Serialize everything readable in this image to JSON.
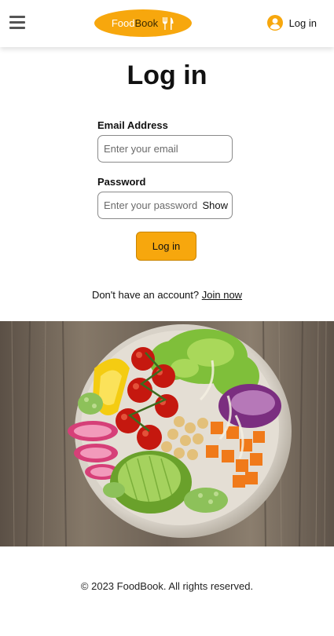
{
  "header": {
    "menu_icon": "hamburger-menu-icon",
    "logo": {
      "part1": "Food",
      "part2": "Book",
      "icon": "fork-knife-icon"
    },
    "login": {
      "icon": "user-circle-icon",
      "label": "Log in"
    }
  },
  "main": {
    "title": "Log in",
    "email": {
      "label": "Email Address",
      "placeholder": "Enter your email",
      "value": ""
    },
    "password": {
      "label": "Password",
      "placeholder": "Enter your password",
      "value": "",
      "toggle_label": "Show"
    },
    "submit_label": "Log in",
    "signup": {
      "prompt": "Don't have an account? ",
      "link": "Join now"
    }
  },
  "hero": {
    "alt": "Salad bowl"
  },
  "footer": {
    "text": "© 2023 FoodBook. All rights reserved."
  },
  "colors": {
    "accent": "#f7a70d",
    "header_bg": "#ffffff",
    "text": "#111111"
  }
}
